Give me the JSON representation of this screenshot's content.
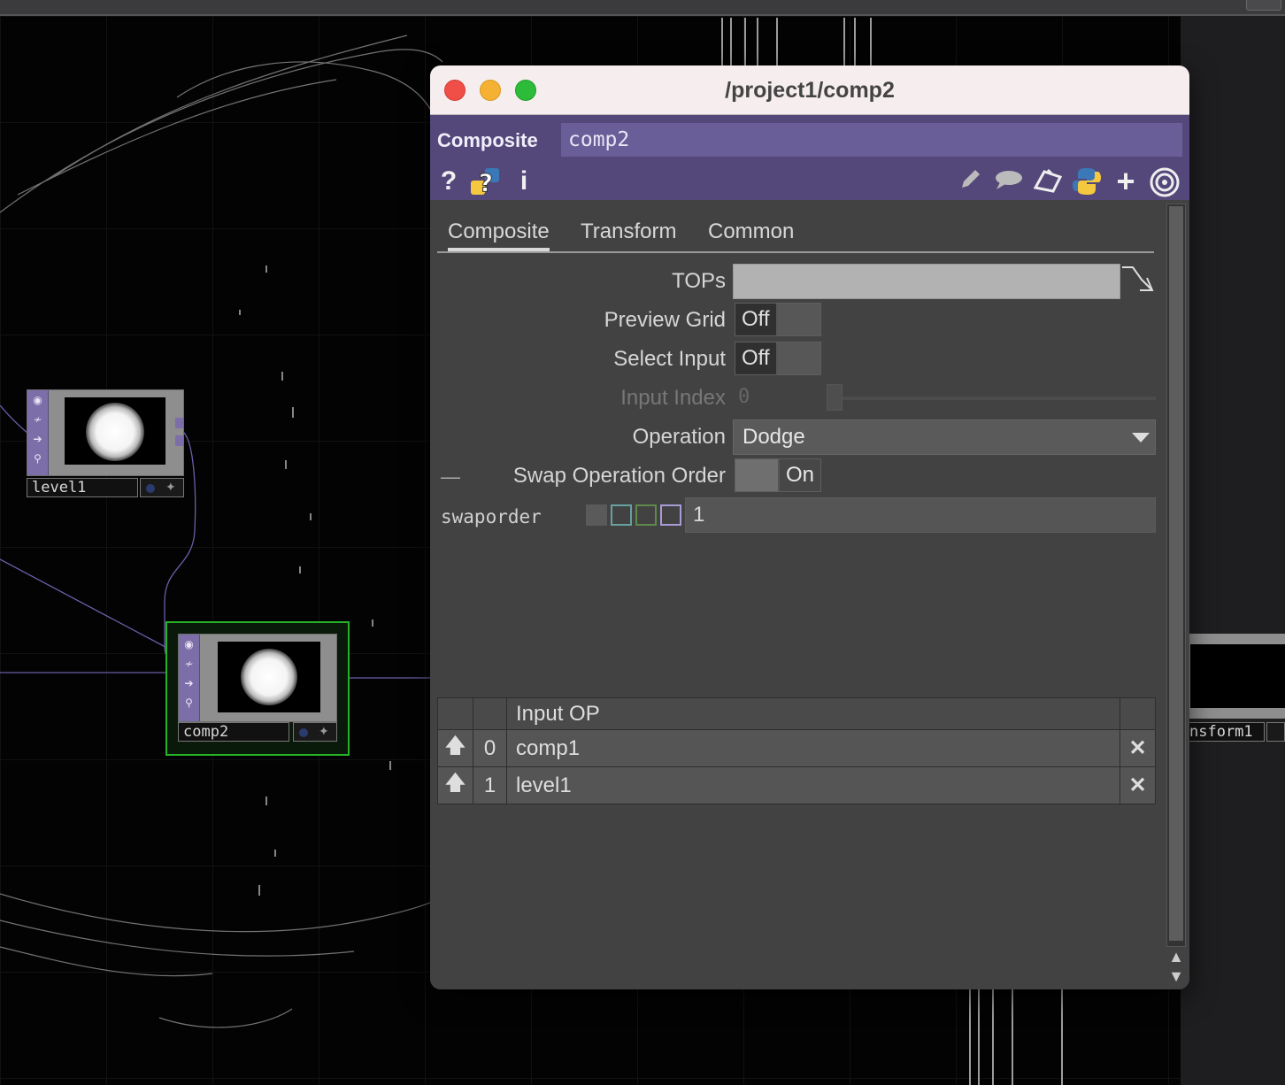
{
  "network": {
    "nodes": [
      {
        "name": "level1"
      },
      {
        "name": "comp2"
      },
      {
        "name_partial": "nsform1"
      }
    ]
  },
  "panel": {
    "window_title": "/project1/comp2",
    "op_type": "Composite",
    "op_name": "comp2",
    "header_icons": [
      "help-icon",
      "python-help-icon",
      "info-icon",
      "edit-icon",
      "comment-icon",
      "clone-icon",
      "python-icon",
      "add-icon",
      "target-icon"
    ],
    "header_glyphs": {
      "help": "?",
      "info": "i",
      "add": "+"
    },
    "tabs": [
      "Composite",
      "Transform",
      "Common"
    ],
    "active_tab": "Composite",
    "params": {
      "tops_label": "TOPs",
      "tops_value": "",
      "preview_grid_label": "Preview Grid",
      "preview_grid_value": "Off",
      "select_input_label": "Select Input",
      "select_input_value": "Off",
      "input_index_label": "Input Index",
      "input_index_value": "0",
      "operation_label": "Operation",
      "operation_value": "Dodge",
      "swap_label": "Swap Operation Order",
      "swap_value": "On",
      "swap_dash": "—",
      "expr_name": "swaporder",
      "expr_value": "1"
    },
    "mode_colors": [
      "#5a5a5a",
      "#66a2a0",
      "#5e8a4a",
      "#a99bd6"
    ],
    "input_table": {
      "header": "Input OP",
      "rows": [
        {
          "index": "0",
          "op": "comp1"
        },
        {
          "index": "1",
          "op": "level1"
        }
      ]
    }
  },
  "colors": {
    "operator_strip": "#7c6ea8",
    "header_bg": "#54487a",
    "selected_node": "#26b226",
    "delete": "#d23a4a",
    "arrow": "#3b8b8a"
  }
}
